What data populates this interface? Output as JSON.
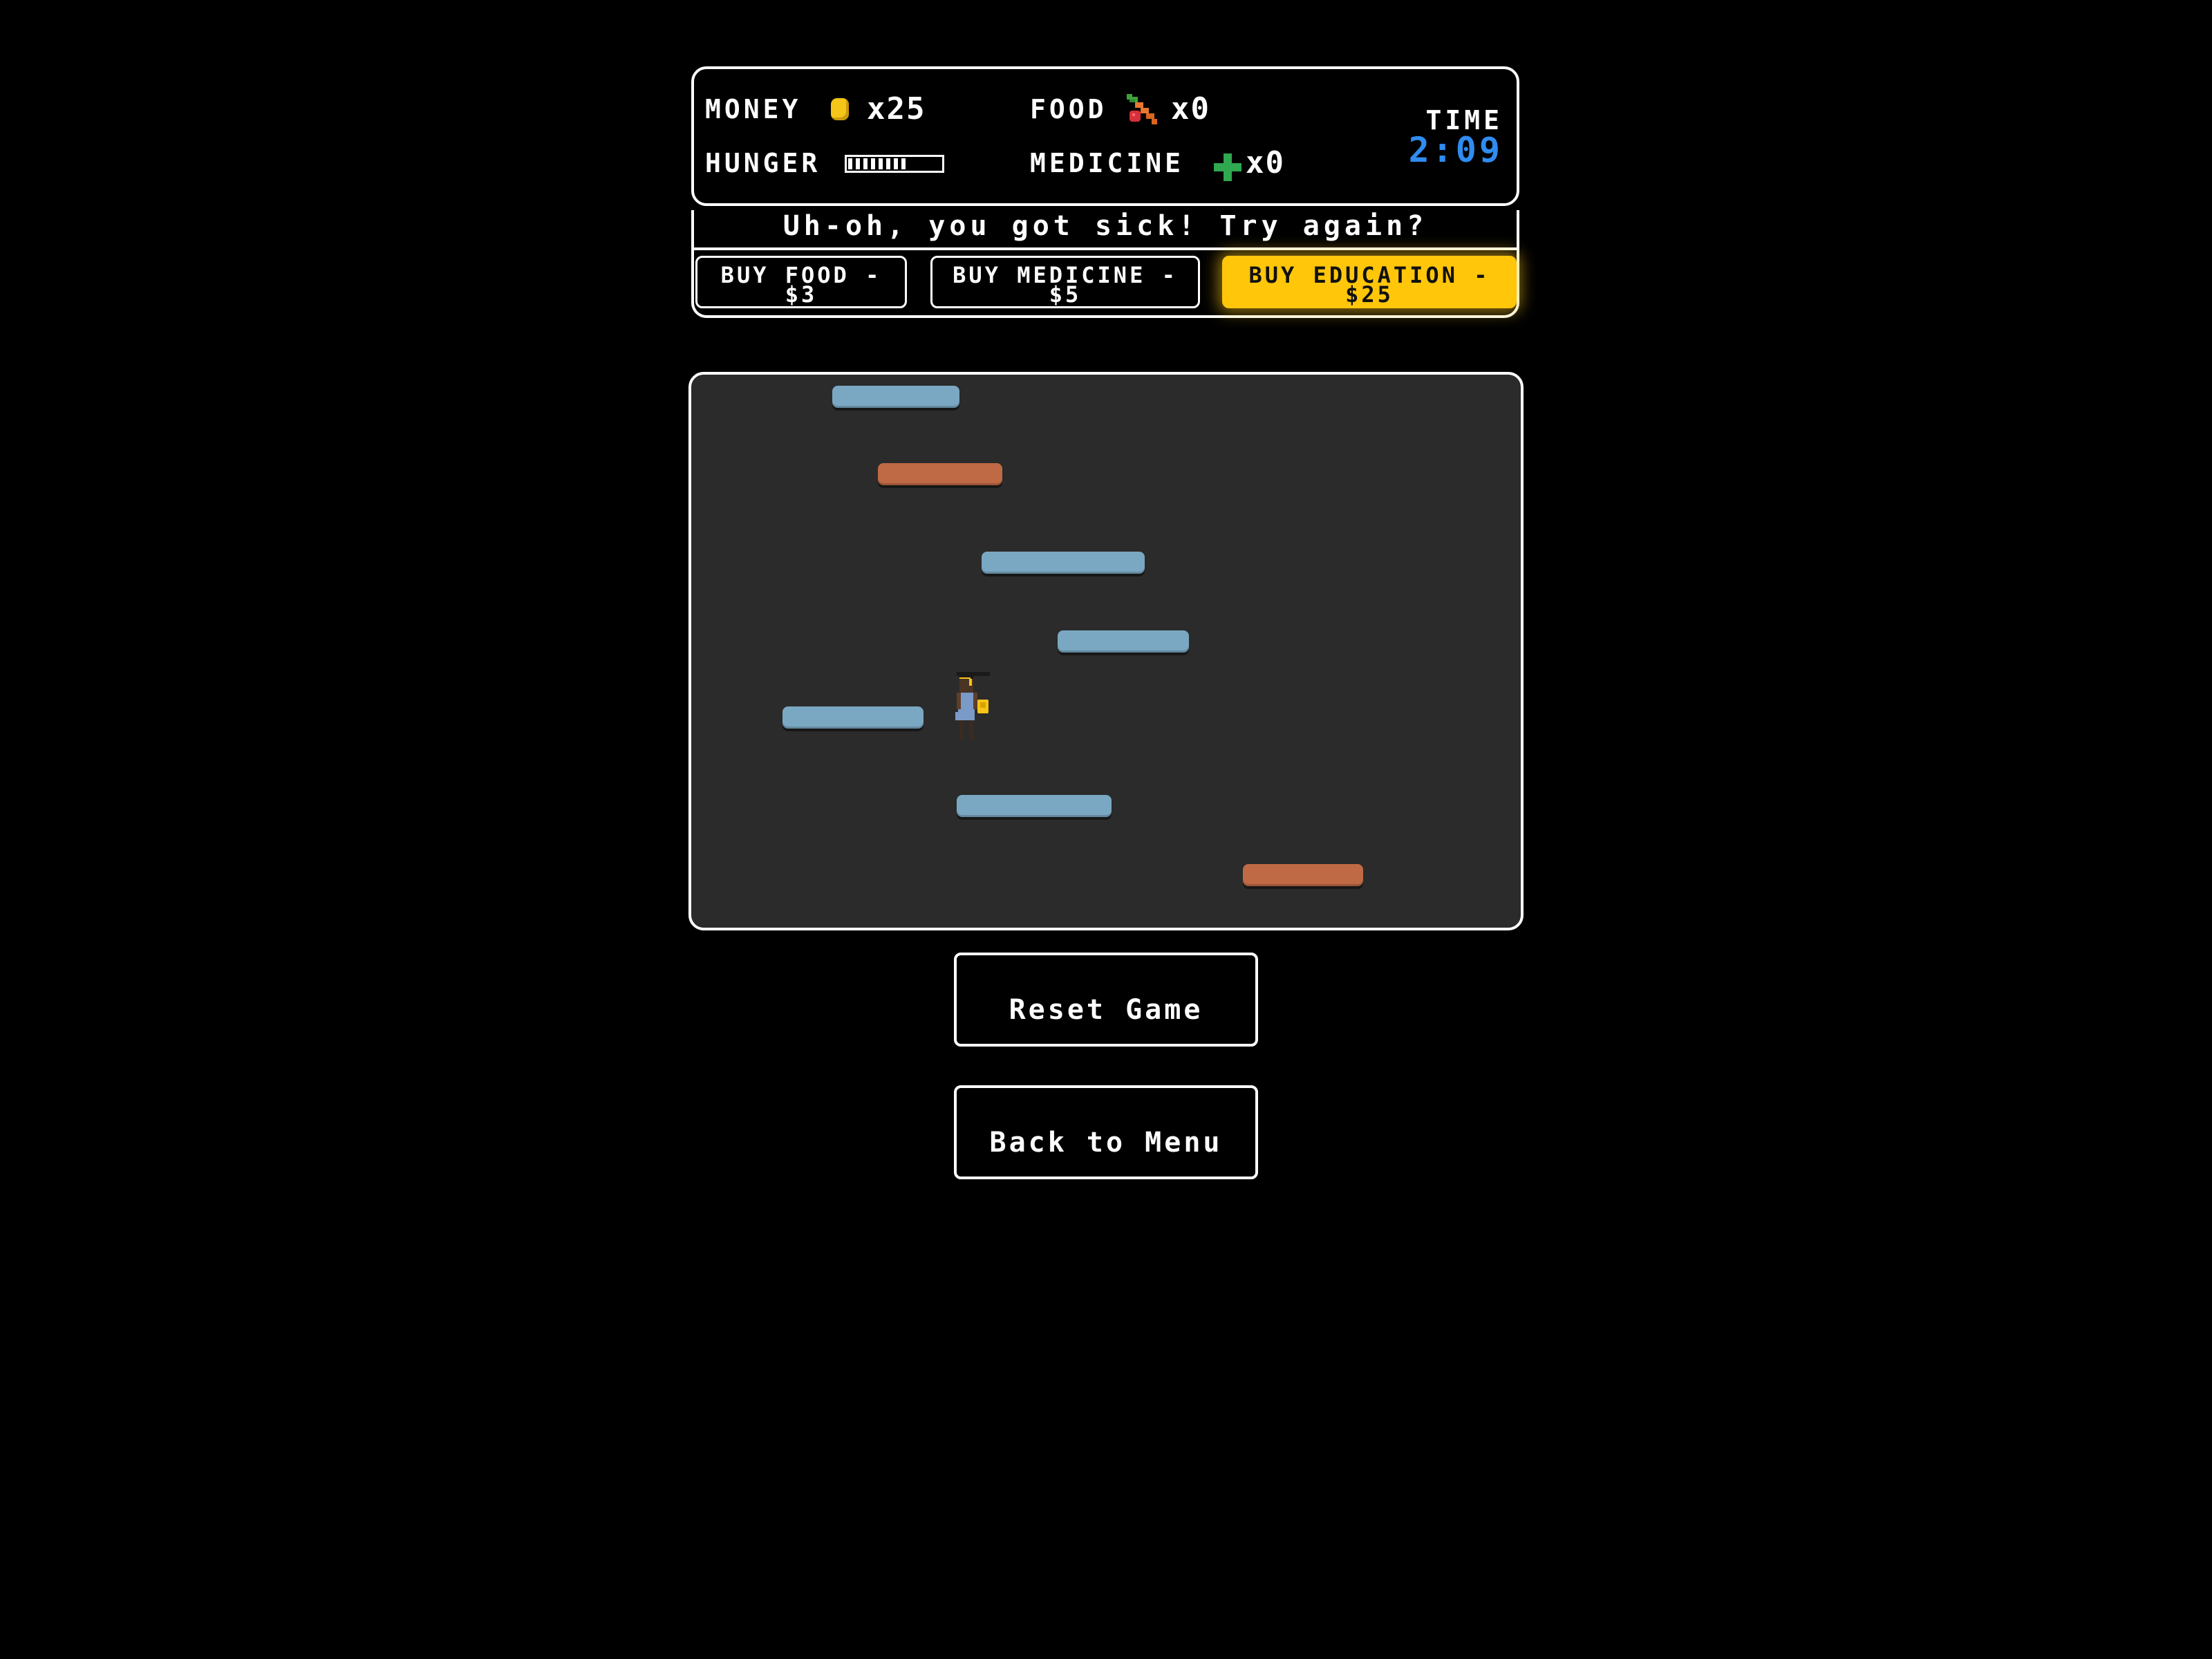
{
  "hud": {
    "money_label": "MONEY",
    "money_icon": "coin-icon",
    "money_value": "x25",
    "food_label": "FOOD",
    "food_icon": "carrot-icon",
    "food_value": "x0",
    "hunger_label": "HUNGER",
    "hunger_level": 0.8,
    "medicine_label": "MEDICINE",
    "medicine_icon": "cross-icon",
    "medicine_value": "x0",
    "time_label": "TIME",
    "time_value": "2:09"
  },
  "message": "Uh-oh, you got sick! Try again?",
  "store": {
    "buy_food": "BUY FOOD - $3",
    "buy_medicine": "BUY MEDICINE - $5",
    "buy_education": "BUY EDUCATION - $25"
  },
  "buttons": {
    "reset": "Reset Game",
    "back": "Back to Menu"
  },
  "colors": {
    "background": "#000000",
    "game_area": "#2b2b2b",
    "platform_blue": "#7aa8c2",
    "platform_orange": "#c06a45",
    "highlight": "#ffc60a",
    "time": "#2f8cf0"
  }
}
